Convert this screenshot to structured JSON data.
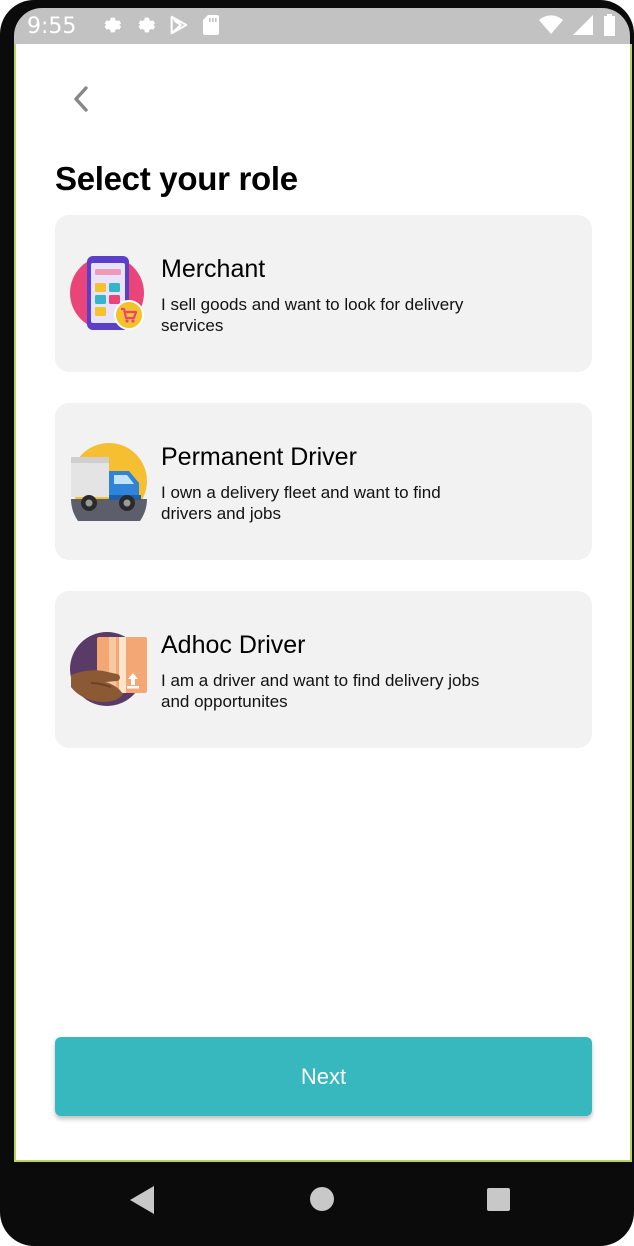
{
  "status_bar": {
    "time": "9:55",
    "icons_left": [
      "settings-icon",
      "settings-icon",
      "play-store-icon",
      "sd-card-icon"
    ],
    "icons_right": [
      "wifi-icon",
      "signal-icon",
      "battery-icon"
    ]
  },
  "page": {
    "title": "Select your role"
  },
  "roles": [
    {
      "title": "Merchant",
      "description": "I sell goods and want to look for delivery services",
      "icon": "merchant-phone-cart-icon"
    },
    {
      "title": "Permanent Driver",
      "description": "I own a delivery fleet and want to find drivers and jobs",
      "icon": "delivery-truck-icon"
    },
    {
      "title": "Adhoc Driver",
      "description": "I am a driver and want to find delivery jobs and opportunites",
      "icon": "hand-package-icon"
    }
  ],
  "actions": {
    "next_label": "Next"
  },
  "colors": {
    "accent": "#37b8be",
    "card_background": "#f2f2f2",
    "status_bar": "#c2c2c2"
  },
  "nav_bar": {
    "buttons": [
      "back-nav-icon",
      "home-nav-icon",
      "recents-nav-icon"
    ]
  }
}
